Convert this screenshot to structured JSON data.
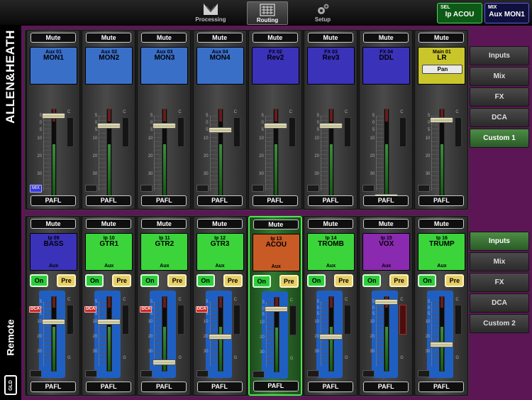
{
  "nav": {
    "tabs": [
      {
        "label": "Processing",
        "icon": "processing-icon"
      },
      {
        "label": "Routing",
        "icon": "routing-icon"
      },
      {
        "label": "Setup",
        "icon": "gear-icon"
      }
    ],
    "active_tab": "Routing"
  },
  "selection": {
    "sel_title": "SEL",
    "sel_value": "Ip ACOU",
    "mix_title": "MIX",
    "mix_value": "Aux MON1"
  },
  "brand": {
    "name": "ALLEN&HEATH",
    "product": "GLD",
    "app": "Remote"
  },
  "top_bank": {
    "channels": [
      {
        "id": "Aux 01",
        "name": "MON1",
        "color": "#3a6fc8",
        "mute": "Mute",
        "pafl": "PAFL",
        "fader_db": 5,
        "badge": "MIX"
      },
      {
        "id": "Aux 02",
        "name": "MON2",
        "color": "#3a6fc8",
        "mute": "Mute",
        "pafl": "PAFL",
        "fader_db": -2
      },
      {
        "id": "Aux 03",
        "name": "MON3",
        "color": "#3a6fc8",
        "mute": "Mute",
        "pafl": "PAFL",
        "fader_db": -2
      },
      {
        "id": "Aux 04",
        "name": "MON4",
        "color": "#3a6fc8",
        "mute": "Mute",
        "pafl": "PAFL",
        "fader_db": -5
      },
      {
        "id": "FX 02",
        "name": "Rev2",
        "color": "#3a32b8",
        "mute": "Mute",
        "pafl": "PAFL",
        "fader_db": -2
      },
      {
        "id": "FX 03",
        "name": "Rev3",
        "color": "#3a32b8",
        "mute": "Mute",
        "pafl": "PAFL",
        "fader_db": -2
      },
      {
        "id": "FX 04",
        "name": "DDL",
        "color": "#3a32b8",
        "mute": "Mute",
        "pafl": "PAFL",
        "fader_db": -60
      },
      {
        "id": "Main 01",
        "name": "LR",
        "color": "#c9c62c",
        "mute": "Mute",
        "pafl": "PAFL",
        "fader_db": 2,
        "pan": "Pan"
      }
    ]
  },
  "bottom_bank": {
    "channels": [
      {
        "id": "Ip 09",
        "name": "BASS",
        "color": "#3a32b8",
        "aux": "Aux",
        "on": "On",
        "pre": "Pre",
        "mute": "Mute",
        "pafl": "PAFL",
        "dca": "DCA",
        "send_db": -10
      },
      {
        "id": "Ip 10",
        "name": "GTR1",
        "color": "#3bd43b",
        "aux": "Aux",
        "on": "On",
        "pre": "Pre",
        "mute": "Mute",
        "pafl": "PAFL",
        "dca": "DCA",
        "send_db": -10
      },
      {
        "id": "Ip 11",
        "name": "GTR2",
        "color": "#3bd43b",
        "aux": "Aux",
        "on": "On",
        "pre": "Pre",
        "mute": "Mute",
        "pafl": "PAFL",
        "dca": "DCA",
        "send_db": -40
      },
      {
        "id": "Ip 12",
        "name": "GTR3",
        "color": "#3bd43b",
        "aux": "Aux",
        "on": "On",
        "pre": "Pre",
        "mute": "Mute",
        "pafl": "PAFL",
        "dca": "DCA",
        "send_db": -20
      },
      {
        "id": "Ip 13",
        "name": "ACOU",
        "color": "#c85a25",
        "aux": "Aux",
        "on": "On",
        "pre": "Pre",
        "mute": "Mute",
        "pafl": "PAFL",
        "send_db": 0,
        "selected": true
      },
      {
        "id": "Ip 14",
        "name": "TROMB",
        "color": "#3bd43b",
        "aux": "Aux",
        "on": "On",
        "pre": "Pre",
        "mute": "Mute",
        "pafl": "PAFL",
        "send_db": -20
      },
      {
        "id": "Ip 15",
        "name": "VOX",
        "color": "#8a2ab0",
        "aux": "Aux",
        "on": "On",
        "pre": "Pre",
        "mute": "Mute",
        "pafl": "PAFL",
        "send_db": 5
      },
      {
        "id": "Ip 16",
        "name": "TRUMP",
        "color": "#3bd43b",
        "aux": "Aux",
        "on": "On",
        "pre": "Pre",
        "mute": "Mute",
        "pafl": "PAFL",
        "send_db": -25
      }
    ]
  },
  "scale_labels": [
    "5",
    "0",
    "5",
    "10",
    "20",
    "30"
  ],
  "meter_labels": {
    "clip": "C",
    "gate": "G"
  },
  "side_top": {
    "items": [
      "Inputs",
      "Mix",
      "FX",
      "DCA",
      "Custom 1"
    ],
    "active": "Custom 1"
  },
  "side_bottom": {
    "items": [
      "Inputs",
      "Mix",
      "FX",
      "DCA",
      "Custom 2"
    ],
    "active": "Inputs"
  }
}
